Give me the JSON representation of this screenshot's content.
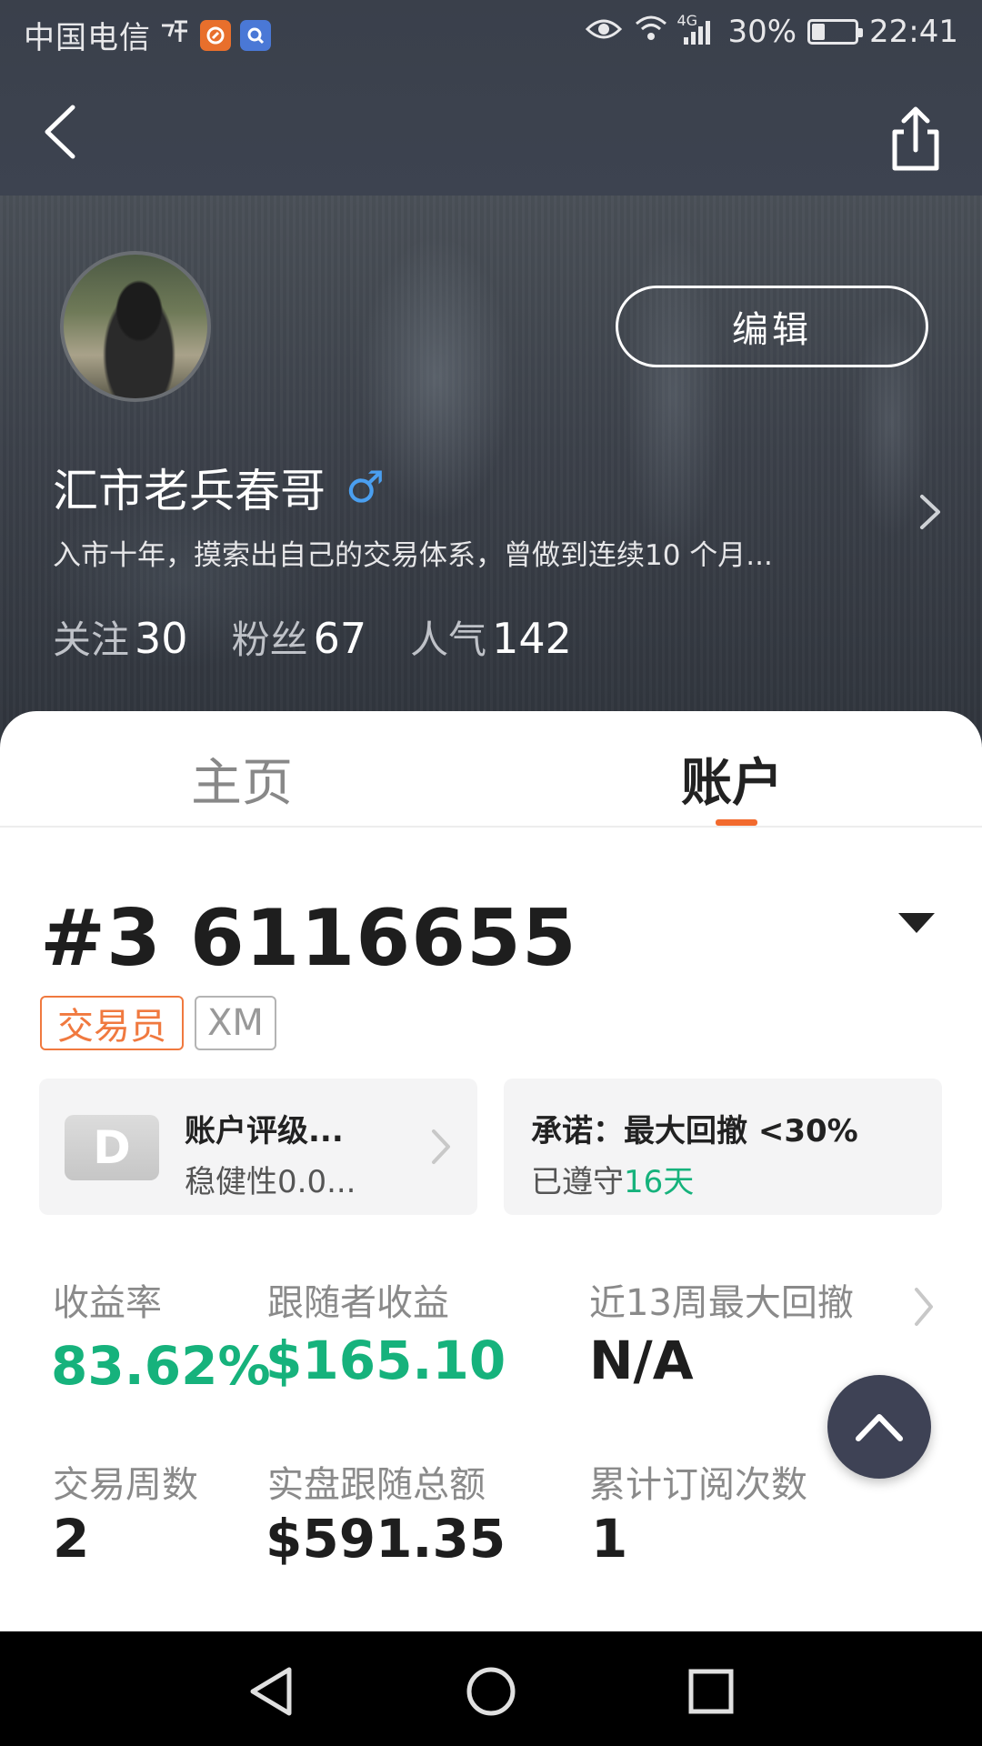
{
  "status_bar": {
    "carrier": "中国电信",
    "signal_extra": "4G",
    "battery_percent": "30%",
    "battery_level": 0.3,
    "time": "22:41"
  },
  "nav": {
    "back_icon": "chevron-left-icon",
    "share_icon": "share-icon"
  },
  "profile": {
    "edit_label": "编辑",
    "username": "汇市老兵春哥",
    "gender_symbol": "♂",
    "bio": "入市十年，摸索出自己的交易体系，曾做到连续10 个月...",
    "stats": {
      "following_label": "关注",
      "following_count": "30",
      "fans_label": "粉丝",
      "fans_count": "67",
      "popularity_label": "人气",
      "popularity_count": "142"
    }
  },
  "tabs": {
    "home": "主页",
    "account": "账户",
    "active": "account",
    "accent_color": "#f26a2e"
  },
  "account": {
    "number": "#3 6116655",
    "tag_trader": "交易员",
    "tag_broker": "XM",
    "rating_card": {
      "badge": "D",
      "title": "账户评级...",
      "subtitle": "稳健性0.0..."
    },
    "promise_card": {
      "title": "承诺：最大回撤 <30%",
      "subtitle_prefix": "已遵守",
      "subtitle_days": "16天"
    }
  },
  "metrics": {
    "return_rate_label": "收益率",
    "return_rate_value": "83.62%",
    "follower_profit_label": "跟随者收益",
    "follower_profit_value": "$165.10",
    "max_drawdown_label": "近13周最大回撤",
    "max_drawdown_value": "N/A",
    "trading_weeks_label": "交易周数",
    "trading_weeks_value": "2",
    "live_follow_total_label": "实盘跟随总额",
    "live_follow_total_value": "$591.35",
    "subscriptions_label": "累计订阅次数",
    "subscriptions_value": "1",
    "positive_color": "#16b27c"
  }
}
